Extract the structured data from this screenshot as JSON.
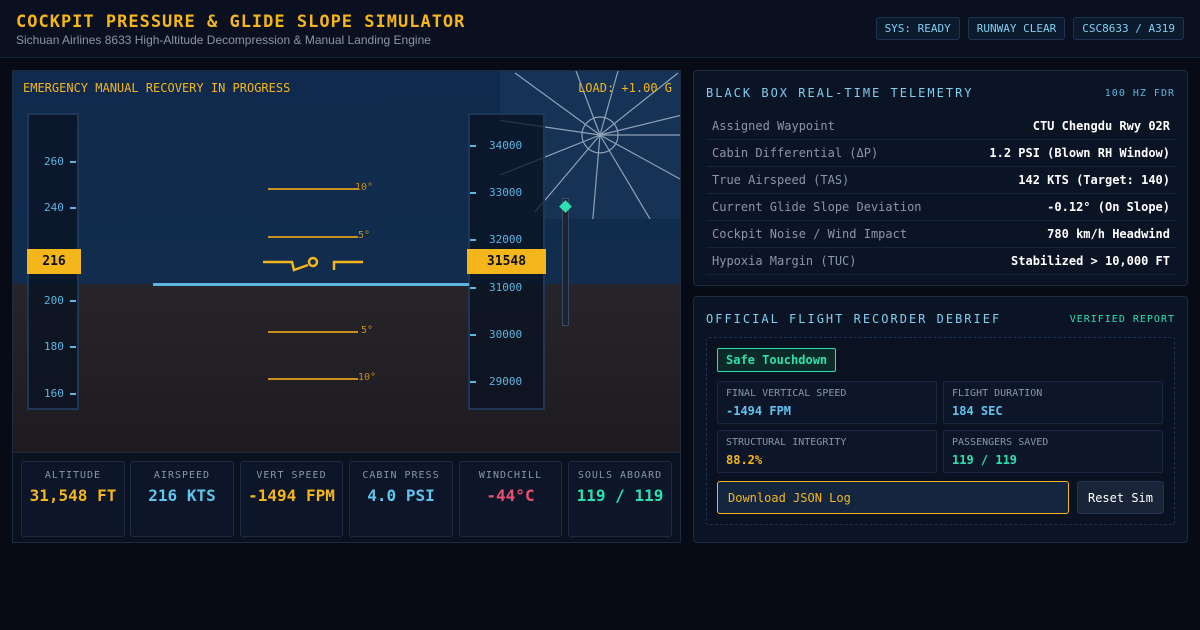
{
  "header": {
    "title": "COCKPIT PRESSURE & GLIDE SLOPE SIMULATOR",
    "subtitle": "Sichuan Airlines 8633 High-Altitude Decompression & Manual Landing Engine",
    "badges": [
      "SYS: READY",
      "RUNWAY CLEAR",
      "CSC8633 / A319"
    ]
  },
  "hud": {
    "status_message": "EMERGENCY MANUAL RECOVERY IN PROGRESS",
    "load": "LOAD: +1.00 G",
    "speed_tape": {
      "ticks": [
        "260",
        "240",
        "200",
        "180",
        "160"
      ],
      "current": "216"
    },
    "altitude_tape": {
      "ticks": [
        "34000",
        "33000",
        "32000",
        "31000",
        "30000",
        "29000"
      ],
      "current": "31548"
    },
    "pitch_labels": [
      "10°",
      "5°",
      "5°",
      "10°"
    ]
  },
  "instruments": [
    {
      "label": "ALTITUDE",
      "value": "31,548 FT",
      "color": "#f5b61c"
    },
    {
      "label": "AIRSPEED",
      "value": "216 KTS",
      "color": "#5fc4ee"
    },
    {
      "label": "VERT SPEED",
      "value": "-1494 FPM",
      "color": "#f5b61c"
    },
    {
      "label": "CABIN PRESS",
      "value": "4.0 PSI",
      "color": "#5fc4ee"
    },
    {
      "label": "WINDCHILL",
      "value": "-44°C",
      "color": "#ef4f70"
    },
    {
      "label": "SOULS ABOARD",
      "value": "119 / 119",
      "color": "#2ee0b0"
    }
  ],
  "telemetry": {
    "title": "BLACK BOX REAL-TIME TELEMETRY",
    "tag": "100 HZ FDR",
    "rows": [
      {
        "key": "Assigned Waypoint",
        "value": "CTU Chengdu Rwy 02R"
      },
      {
        "key": "Cabin Differential (ΔP)",
        "value": "1.2 PSI (Blown RH Window)"
      },
      {
        "key": "True Airspeed (TAS)",
        "value": "142 KTS (Target: 140)"
      },
      {
        "key": "Current Glide Slope Deviation",
        "value": "-0.12° (On Slope)"
      },
      {
        "key": "Cockpit Noise / Wind Impact",
        "value": "780 km/h Headwind"
      },
      {
        "key": "Hypoxia Margin (TUC)",
        "value": "Stabilized > 10,000 FT"
      }
    ]
  },
  "debrief": {
    "title": "OFFICIAL FLIGHT RECORDER DEBRIEF",
    "tag": "VERIFIED REPORT",
    "result": "Safe Touchdown",
    "stats": [
      {
        "label": "FINAL VERTICAL SPEED",
        "value": "-1494 FPM",
        "color": "#5fc4ee"
      },
      {
        "label": "FLIGHT DURATION",
        "value": "184 SEC",
        "color": "#5fc4ee"
      },
      {
        "label": "STRUCTURAL INTEGRITY",
        "value": "88.2%",
        "color": "#f5b61c"
      },
      {
        "label": "PASSENGERS SAVED",
        "value": "119 / 119",
        "color": "#2ee0b0"
      }
    ],
    "download_label": "Download JSON Log",
    "reset_label": "Reset Sim"
  }
}
